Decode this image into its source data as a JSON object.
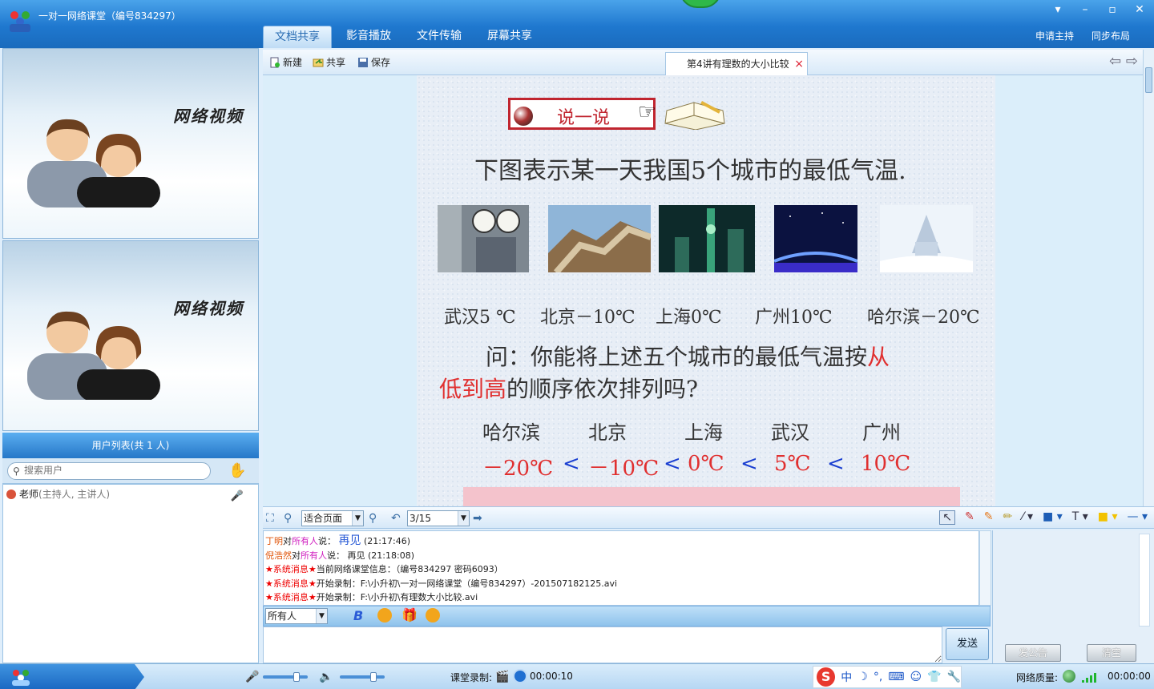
{
  "window": {
    "title": "一对一网络课堂（编号834297）",
    "controls": [
      "▾",
      "–",
      "▫",
      "✕"
    ]
  },
  "main_tabs": [
    {
      "label": "文档共享",
      "active": true
    },
    {
      "label": "影音播放",
      "active": false
    },
    {
      "label": "文件传输",
      "active": false
    },
    {
      "label": "屏幕共享",
      "active": false
    }
  ],
  "top_right": {
    "apply_host": "申请主持",
    "sync_layout": "同步布局"
  },
  "video": {
    "label1": "网络视频",
    "label2": "网络视频"
  },
  "user_list": {
    "header": "用户列表(共 1 人)",
    "search_placeholder": "搜索用户",
    "users": [
      {
        "name": "老师",
        "role": "(主持人, 主讲人)"
      }
    ]
  },
  "doc_toolbar": {
    "new": "新建",
    "share": "共享",
    "save": "保存",
    "tab_title": "第4讲有理数的大小比较",
    "close": "×",
    "back": "⇦",
    "forward": "⇨"
  },
  "slide": {
    "badge": "说一说",
    "line1": "下图表示某一天我国5个城市的最低气温.",
    "cities_temps": [
      "武汉5 ℃",
      "北京－10℃",
      "上海0℃",
      "广州10℃",
      "哈尔滨－20℃"
    ],
    "question_a": "问：你能将上述五个城市的最低气温按",
    "question_red_a": "从",
    "question_red_b": "低到高",
    "question_b": "的顺序依次排列吗?",
    "order_cities": [
      "哈尔滨",
      "北京",
      "上海",
      "武汉",
      "广州"
    ],
    "order_temps": [
      "－20℃",
      "－10℃",
      "0℃",
      "5℃",
      "10℃"
    ],
    "less_than": "<"
  },
  "doc_bottom": {
    "zoom": "适合页面",
    "page": "3/15"
  },
  "chat": {
    "messages": [
      {
        "sender": "丁明",
        "to_word": "对",
        "target": "所有人",
        "say": "说：",
        "text": "再见",
        "time": "(21:17:46)",
        "big": true
      },
      {
        "sender": "倪浩然",
        "to_word": "对",
        "target": "所有人",
        "say": "说：",
        "text": "再见",
        "time": "(21:18:08)",
        "big": false
      }
    ],
    "system_label": "★系统消息★",
    "system": [
      "当前网络课堂信息：（编号834297 密码6093）",
      "开始录制：F:\\小升初\\一对一网络课堂（编号834297）-201507182125.avi",
      "开始录制：F:\\小升初\\有理数大小比较.avi"
    ],
    "recipient": "所有人",
    "send": "发送",
    "post_notice": "发公告",
    "clear": "清空"
  },
  "status": {
    "record_label": "课堂录制:",
    "record_time": "00:00:10",
    "ime": [
      "中",
      "☽",
      "°,",
      "⌨",
      "☺",
      "👕",
      "🔧"
    ],
    "net_quality_label": "网络质量:",
    "net_time": "00:00:00"
  }
}
